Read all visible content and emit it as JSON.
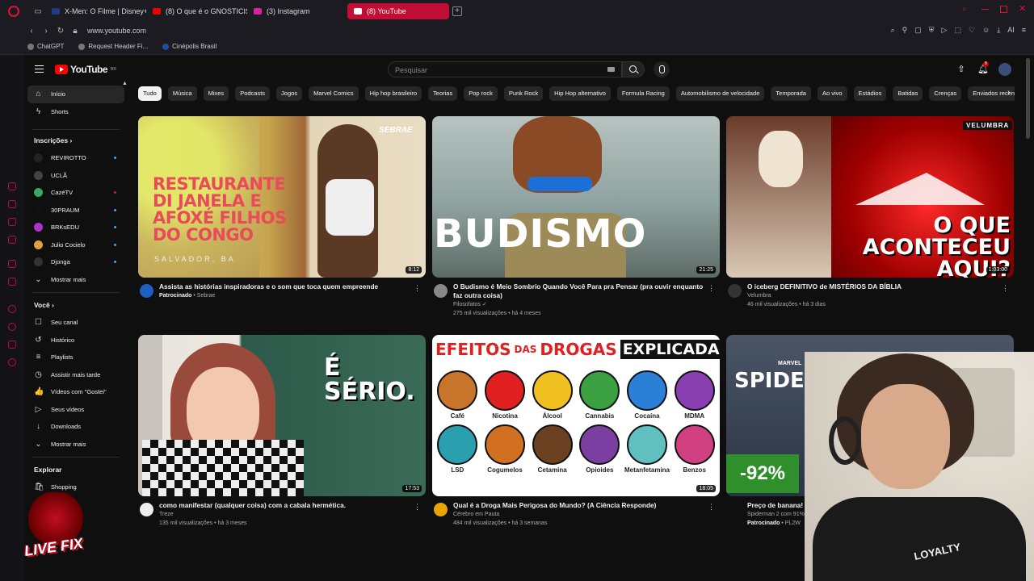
{
  "browser": {
    "tabs": [
      {
        "label": "X-Men: O Filme | Disney+",
        "color": "#1f3c88"
      },
      {
        "label": "(8) O que é o GNOSTICISMO?",
        "color": "#e00"
      },
      {
        "label": "(3) Instagram",
        "color": "#d6249f"
      },
      {
        "label": "(8) YouTube",
        "color": "#fff"
      }
    ],
    "url": "www.youtube.com",
    "bookmarks": [
      "ChatGPT",
      "Request Header Fi...",
      "Cinépolis Brasil"
    ],
    "ai_label": "AI"
  },
  "header": {
    "logo_text": "YouTube",
    "region": "BR",
    "search_placeholder": "Pesquisar",
    "notifications": "8"
  },
  "sidebar": {
    "main": [
      {
        "label": "Início",
        "icon": "home-icon",
        "glyph": "⌂"
      },
      {
        "label": "Shorts",
        "icon": "shorts-icon",
        "glyph": "⚡"
      }
    ],
    "subscriptions_title": "Inscrições",
    "subscriptions": [
      {
        "label": "REVIROTTO",
        "color": "#222",
        "dot": "blue"
      },
      {
        "label": "UCLÃ",
        "color": "#444",
        "dot": ""
      },
      {
        "label": "CazéTV",
        "color": "#3a6",
        "dot": "red"
      },
      {
        "label": "30PRAUM",
        "color": "#111",
        "dot": "blue"
      },
      {
        "label": "BRKsEDU",
        "color": "#a3c",
        "dot": "blue"
      },
      {
        "label": "Julio Cocielo",
        "color": "#d9a43a",
        "dot": "blue"
      },
      {
        "label": "Djonga",
        "color": "#333",
        "dot": "blue"
      }
    ],
    "show_more": "Mostrar mais",
    "you_title": "Você",
    "you_items": [
      {
        "label": "Seu canal",
        "glyph": "☐",
        "icon": "channel-icon"
      },
      {
        "label": "Histórico",
        "glyph": "↺",
        "icon": "history-icon"
      },
      {
        "label": "Playlists",
        "glyph": "≡",
        "icon": "playlists-icon"
      },
      {
        "label": "Assistir mais tarde",
        "glyph": "◷",
        "icon": "watch-later-icon"
      },
      {
        "label": "Vídeos com \"Gostei\"",
        "glyph": "👍",
        "icon": "liked-icon"
      },
      {
        "label": "Seus vídeos",
        "glyph": "▷",
        "icon": "your-videos-icon"
      },
      {
        "label": "Downloads",
        "glyph": "↓",
        "icon": "downloads-icon"
      },
      {
        "label": "Mostrar mais",
        "glyph": "⌄",
        "icon": "chevron-down-icon"
      }
    ],
    "explore_title": "Explorar",
    "explore_items": [
      {
        "label": "Shopping",
        "glyph": "🛍",
        "icon": "shopping-icon"
      }
    ]
  },
  "chips": [
    "Tudo",
    "Música",
    "Mixes",
    "Podcasts",
    "Jogos",
    "Marvel Comics",
    "Hip hop brasileiro",
    "Teorias",
    "Pop rock",
    "Punk Rock",
    "Hip Hop alternativo",
    "Formula Racing",
    "Automobilismo de velocidade",
    "Temporada",
    "Ao vivo",
    "Estádios",
    "Batidas",
    "Crenças",
    "Enviados recen"
  ],
  "videos": [
    {
      "title": "Assista as histórias inspiradoras e o som que toca quem empreende",
      "channel": "Patrocinado",
      "channel2": "Sebrae",
      "stats": "",
      "duration": "8:12",
      "thumb_text": "RESTAURANTE DI JANELA E AFOXÉ FILHOS DO CONGO",
      "thumb_sub": "SALVADOR, BA",
      "badge": "SEBRAE",
      "av_color": "#1f5fbf"
    },
    {
      "title": "O Budismo é Meio Sombrio Quando Você Para pra Pensar (pra ouvir enquanto faz outra coisa)",
      "channel": "Filosofatos",
      "channel2": "",
      "stats": "275 mil visualizações • há 4 meses",
      "duration": "21:25",
      "thumb_text": "BUDISMO",
      "av_color": "#888"
    },
    {
      "title": "O iceberg DEFINITIVO de MISTÉRIOS DA BÍBLIA",
      "channel": "Velumbra",
      "channel2": "",
      "stats": "46 mil visualizações • há 3 dias",
      "duration": "1:03:00",
      "thumb_text": "O QUE ACONTECEU AQUI?",
      "badge": "VELUMBRA",
      "av_color": "#333"
    },
    {
      "title": "como manifestar (qualquer coisa) com a cabala hermética.",
      "channel": "Treze",
      "channel2": "",
      "stats": "135 mil visualizações • há 3 meses",
      "duration": "17:53",
      "thumb_text": "É SÉRIO.",
      "av_color": "#eee"
    },
    {
      "title": "Qual é a Droga Mais Perigosa do Mundo? (A Ciência Responde)",
      "channel": "Cérebro em Pauta",
      "channel2": "",
      "stats": "484 mil visualizações • há 3 semanas",
      "duration": "18:05",
      "thumb_title_a": "EFEITOS",
      "thumb_title_b": "DAS",
      "thumb_title_c": "DROGAS",
      "thumb_title_d": "EXPLICADAS",
      "drugs": [
        "Café",
        "Nicotina",
        "Álcool",
        "Cannabis",
        "Cocaína",
        "MDMA",
        "LSD",
        "Cogumelos",
        "Cetamina",
        "Opioides",
        "Metanfetamina",
        "Benzos"
      ],
      "av_color": "#e8a500"
    },
    {
      "title": "Preço de banana!",
      "channel": "Spiderman 2 com 91% de",
      "channel2": "",
      "sponsor": "Patrocinado",
      "sponsor2": "PL2W",
      "thumb_text": "SPIDER-M",
      "thumb_brand": "MARVEL",
      "discount": "-92%",
      "av_color": "#555"
    }
  ],
  "overlay": {
    "logo_text": "LIVE FIX",
    "shirt_text": "LOYALTY"
  }
}
